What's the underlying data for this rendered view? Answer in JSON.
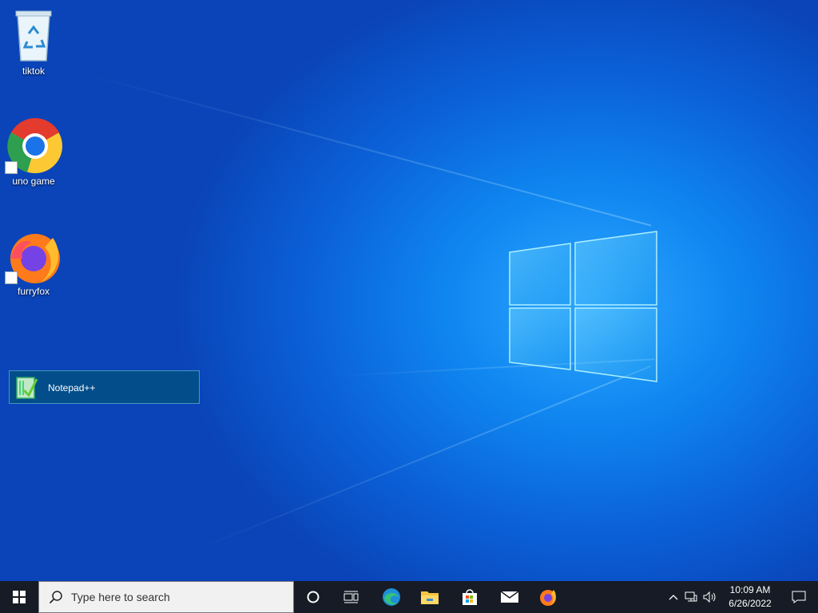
{
  "desktop": {
    "icons": [
      {
        "label": "tiktok",
        "icon": "recycle-bin-icon"
      },
      {
        "label": "uno game",
        "icon": "chrome-icon"
      },
      {
        "label": "furryfox",
        "icon": "firefox-icon"
      }
    ],
    "drag_item": {
      "label": "Notepad++",
      "icon": "notepad-plus-plus-icon"
    }
  },
  "taskbar": {
    "search_placeholder": "Type here to search",
    "pinned": [
      "cortana-icon",
      "task-view-icon",
      "edge-icon",
      "file-explorer-icon",
      "store-icon",
      "mail-icon",
      "firefox-icon"
    ],
    "clock": {
      "time": "10:09 AM",
      "date": "6/26/2022"
    }
  },
  "colors": {
    "taskbar": "#161b25",
    "wallpaper_accent": "#0f86f0"
  }
}
